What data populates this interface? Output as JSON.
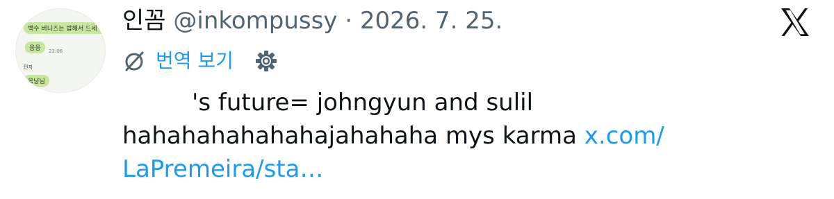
{
  "header": {
    "display_name": "인꼼",
    "handle": "@inkompussy",
    "separator": "·",
    "date": "2026. 7. 25."
  },
  "translate": {
    "label": "번역 보기"
  },
  "tweet": {
    "line1": "'s future= johngyun and sulil",
    "line2_text": "hahahahahahahajahahaha mys karma ",
    "link_part1": "x.com/",
    "link_part2": "LaPremeira/sta…"
  },
  "avatar_image": {
    "bubble1": "백수 버니즈는 밥해서 드세",
    "bubble2": "응응",
    "time2": "23:06",
    "name": "민지",
    "bubble3": "옥냥님"
  },
  "colors": {
    "link": "#1d9bf0",
    "meta": "#536471",
    "text": "#0f1419"
  },
  "icons": [
    "globe-slash-icon",
    "gear-icon",
    "x-logo-icon"
  ]
}
